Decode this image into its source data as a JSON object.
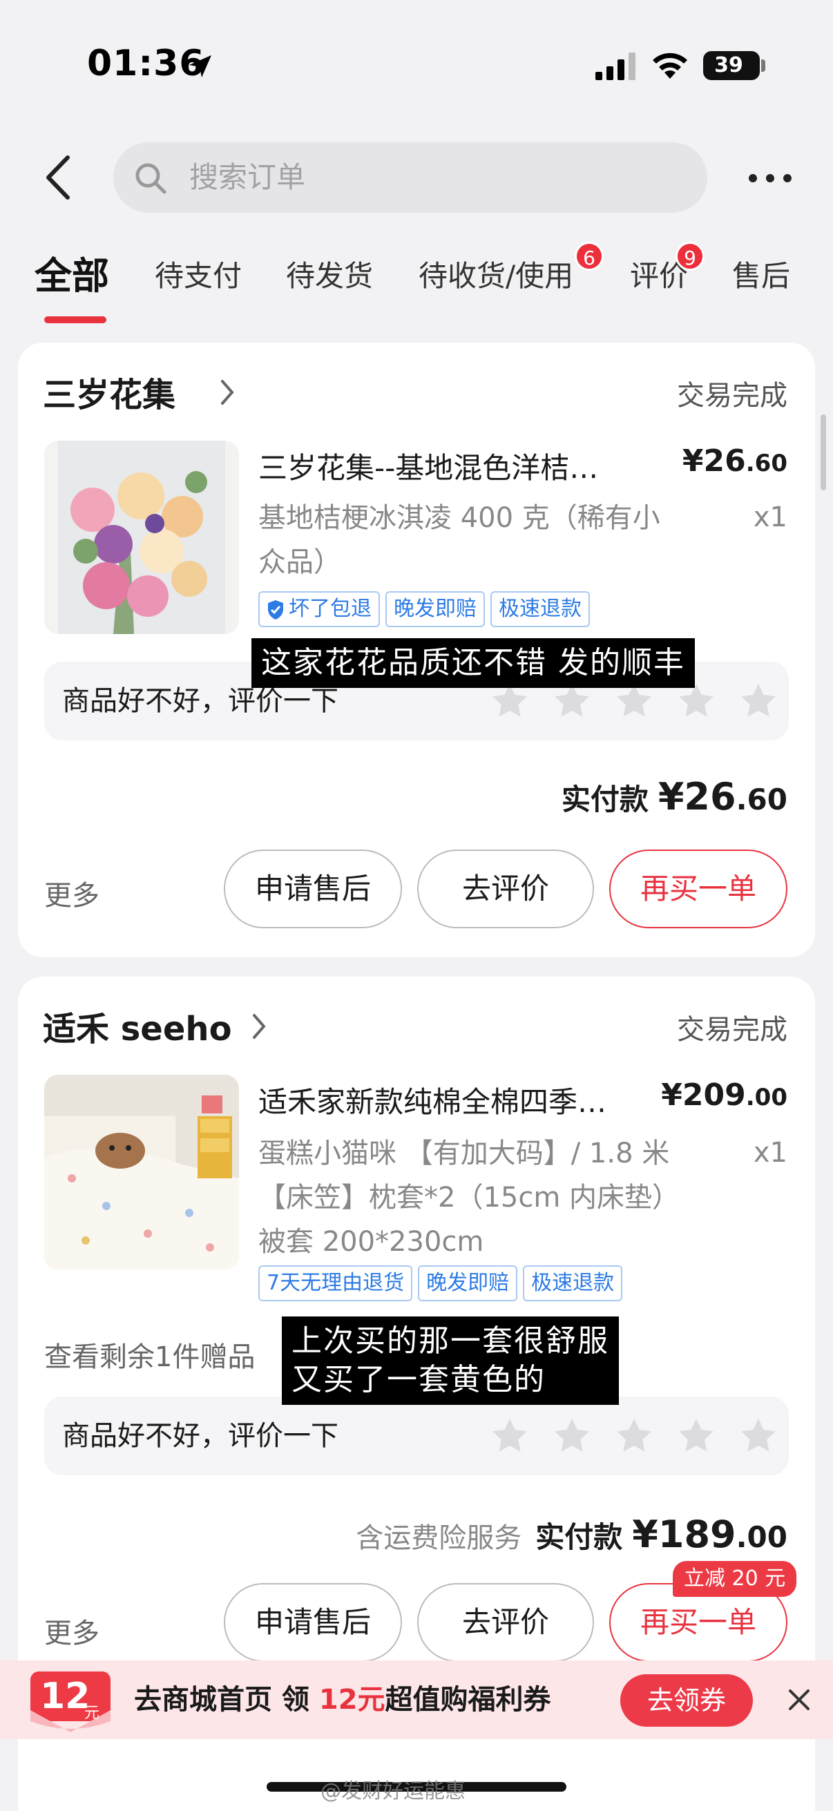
{
  "status_bar": {
    "time": "01:36",
    "battery": "39"
  },
  "search": {
    "placeholder": "搜索订单"
  },
  "tabs": [
    {
      "label": "全部"
    },
    {
      "label": "待支付"
    },
    {
      "label": "待发货"
    },
    {
      "label": "待收货/使用",
      "badge": "6"
    },
    {
      "label": "评价",
      "badge": "9"
    },
    {
      "label": "售后"
    }
  ],
  "orders": [
    {
      "shop": "三岁花集",
      "status": "交易完成",
      "title": "三岁花集--基地混色洋桔…",
      "price_main": "¥26",
      "price_decimal": ".60",
      "spec": "基地桔梗冰淇凌 400 克（稀有小众品）",
      "qty": "x1",
      "tags": [
        "坏了包退",
        "晚发即赔",
        "极速退款"
      ],
      "review_prompt": "商品好不好，评价一下",
      "paid_label": "实付款",
      "paid_main": "¥26",
      "paid_decimal": ".60",
      "more": "更多",
      "buttons": [
        "申请售后",
        "去评价",
        "再买一单"
      ],
      "subtitle": "这家花花品质还不错  发的顺丰"
    },
    {
      "shop": "适禾 seeho",
      "status": "交易完成",
      "title": "适禾家新款纯棉全棉四季…",
      "price_main": "¥209",
      "price_decimal": ".00",
      "spec": "蛋糕小猫咪      【有加大码】/ 1.8 米【床笠】枕套*2（15cm 内床垫）被套 200*230cm",
      "qty": "x1",
      "tags": [
        "7天无理由退货",
        "晚发即赔",
        "极速退款"
      ],
      "gift": "查看剩余1件赠品",
      "review_prompt": "商品好不好，评价一下",
      "insurance": "含运费险服务",
      "paid_label": "实付款",
      "paid_main": "¥189",
      "paid_decimal": ".00",
      "more": "更多",
      "buttons": [
        "申请售后",
        "去评价",
        "再买一单"
      ],
      "promo": "立减 20 元",
      "subtitle_line1": "上次买的那一套很舒服",
      "subtitle_line2": "又买了一套黄色的"
    }
  ],
  "banner": {
    "coupon_amount": "12",
    "coupon_unit": "元",
    "text_before": "去商城首页 领 ",
    "text_highlight": "12元",
    "text_after": "超值购福利券",
    "claim": "去领券"
  },
  "watermark": "@发财好运能惠",
  "colors": {
    "accent": "#e8333f",
    "tag_blue": "#2d7be5",
    "background": "#f2f2f4"
  }
}
